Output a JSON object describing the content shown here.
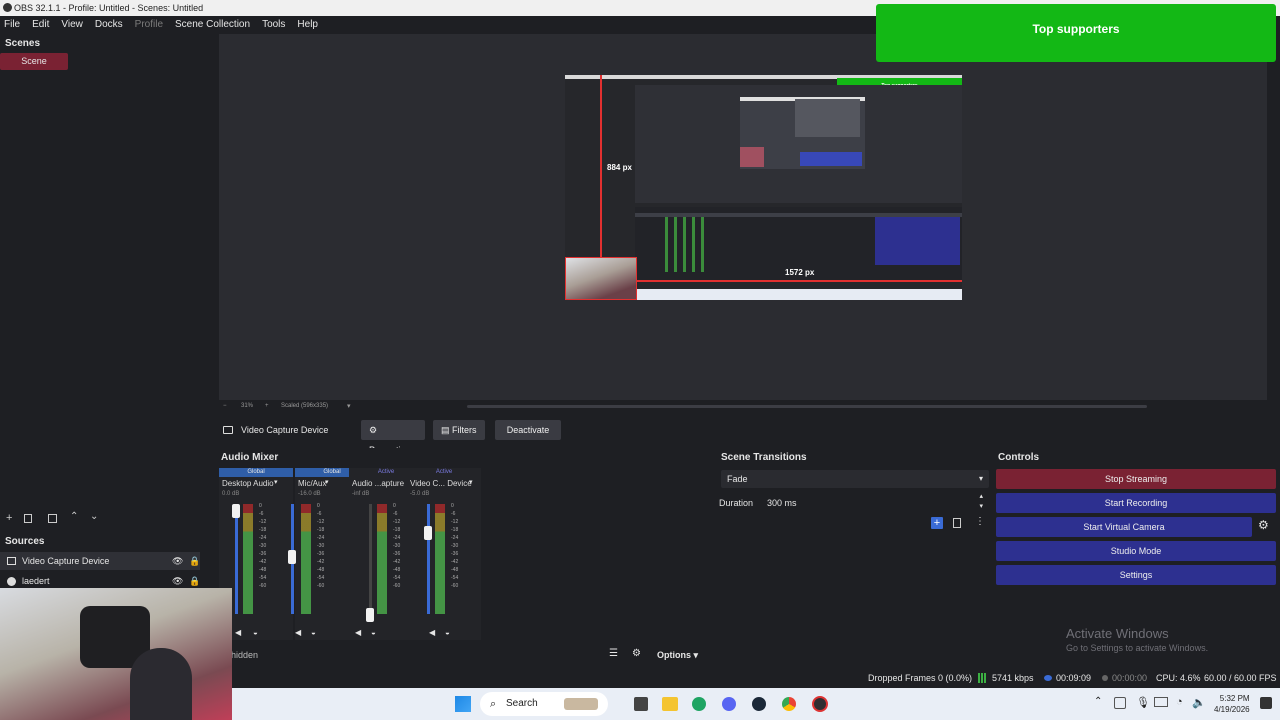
{
  "titlebar": {
    "title": "OBS 32.1.1 - Profile: Untitled - Scenes: Untitled"
  },
  "menu": {
    "items": [
      "File",
      "Edit",
      "View",
      "Docks",
      "Profile",
      "Scene Collection",
      "Tools",
      "Help"
    ]
  },
  "scenes": {
    "title": "Scenes",
    "items": [
      "Scene"
    ]
  },
  "preview": {
    "top_supporters": "Top supporters",
    "inner_top_supporters": "Top supporters",
    "height_label": "884 px",
    "width_label": "1572 px",
    "zoom": "31%",
    "scaled": "Scaled (596x335)"
  },
  "source_toolbar": {
    "selected_source": "Video Capture Device",
    "properties": "Properties",
    "filters": "Filters",
    "deactivate": "Deactivate"
  },
  "audio_mixer": {
    "title": "Audio Mixer",
    "hidden": "hidden",
    "channels": [
      {
        "tab": "Global",
        "name": "Desktop Audio",
        "db": "0.0 dB"
      },
      {
        "tab": "Global",
        "name": "Mic/Aux",
        "db": "-16.0 dB"
      },
      {
        "tab": "Active",
        "name": "Audio ...apture",
        "db": "-inf dB"
      },
      {
        "tab": "Active",
        "name": "Video C... Device",
        "db": "-5.0 dB"
      }
    ],
    "scale": [
      "0",
      "-6",
      "-12",
      "-18",
      "-24",
      "-30",
      "-36",
      "-42",
      "-48",
      "-54",
      "-60"
    ],
    "options": "Options"
  },
  "transitions": {
    "title": "Scene Transitions",
    "selected": "Fade",
    "duration_label": "Duration",
    "duration_value": "300 ms"
  },
  "controls": {
    "title": "Controls",
    "stop_streaming": "Stop Streaming",
    "start_recording": "Start Recording",
    "start_virtual_camera": "Start Virtual Camera",
    "studio_mode": "Studio Mode",
    "settings": "Settings"
  },
  "sources": {
    "title": "Sources",
    "items": [
      "Video Capture Device",
      "laedert"
    ]
  },
  "activate_windows": {
    "title": "Activate Windows",
    "subtitle": "Go to Settings to activate Windows."
  },
  "statusbar": {
    "dropped": "Dropped Frames 0 (0.0%)",
    "bitrate": "5741 kbps",
    "stream_time": "00:09:09",
    "rec_time": "00:00:00",
    "cpu": "CPU: 4.6%",
    "fps": "60.00 / 60.00 FPS"
  },
  "taskbar": {
    "search": "Search",
    "time": "5:32 PM",
    "date": "4/19/2026"
  },
  "colors": {
    "accent_red": "#7a2233",
    "button_blue": "#2d3090",
    "supporters_green": "#13b815"
  }
}
